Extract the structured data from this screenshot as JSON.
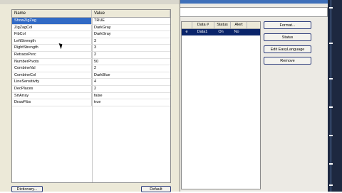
{
  "grid": {
    "headers": {
      "name": "Name",
      "value": "Value"
    },
    "rows": [
      {
        "name": "ShowZigZag",
        "value": "TRUE"
      },
      {
        "name": "ZigZagCol",
        "value": "DarkGray"
      },
      {
        "name": "FibCol",
        "value": "DarkGray"
      },
      {
        "name": "LeftStrength",
        "value": "3"
      },
      {
        "name": "RightStrength",
        "value": "3"
      },
      {
        "name": "RetracePerc",
        "value": "2"
      },
      {
        "name": "NumberPivots",
        "value": "50"
      },
      {
        "name": "CombineVal",
        "value": "2"
      },
      {
        "name": "CombineCol",
        "value": "DarkBlue"
      },
      {
        "name": "LineSensitivity",
        "value": "4"
      },
      {
        "name": "DecPlaces",
        "value": "2"
      },
      {
        "name": "SrtArray",
        "value": "false"
      },
      {
        "name": "DrawFibs",
        "value": "true"
      }
    ]
  },
  "dialog_buttons": {
    "dictionary": "Dictionary...",
    "default": "Default"
  },
  "bg_list": {
    "headers": [
      "",
      "Data #",
      "Status",
      "Alert"
    ],
    "row": [
      "e",
      "Data1",
      "On",
      "No"
    ]
  },
  "right_buttons": {
    "format": "Format...",
    "status": "Status",
    "edit_easylanguage": "Edit EasyLanguage",
    "remove": "Remove"
  }
}
